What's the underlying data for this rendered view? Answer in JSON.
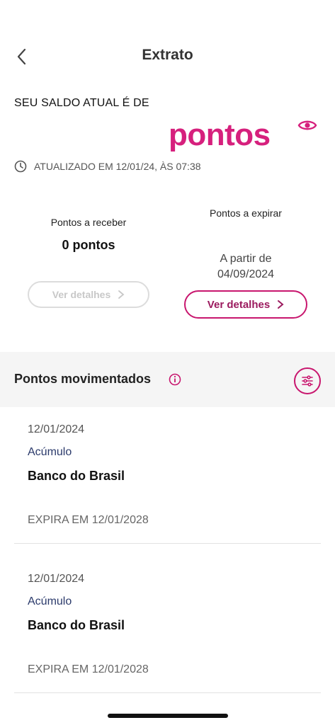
{
  "header": {
    "title": "Extrato"
  },
  "balance": {
    "label": "SEU SALDO ATUAL É DE",
    "unit": "pontos",
    "updated": "ATUALIZADO EM 12/01/24, ÀS 07:38"
  },
  "cards": {
    "receive": {
      "label": "Pontos a receber",
      "value": "0 pontos",
      "button": "Ver detalhes"
    },
    "expire": {
      "label": "Pontos a expirar",
      "since_line1": "A partir de",
      "since_line2": "04/09/2024",
      "button": "Ver detalhes"
    }
  },
  "movements": {
    "title": "Pontos movimentados",
    "items": [
      {
        "date": "12/01/2024",
        "type": "Acúmulo",
        "partner": "Banco do Brasil",
        "expiry": "EXPIRA EM 12/01/2028"
      },
      {
        "date": "12/01/2024",
        "type": "Acúmulo",
        "partner": "Banco do Brasil",
        "expiry": "EXPIRA EM 12/01/2028"
      }
    ]
  },
  "colors": {
    "accent": "#d6207d",
    "accent_dark": "#c8166e",
    "type_text": "#2b3a6b"
  }
}
